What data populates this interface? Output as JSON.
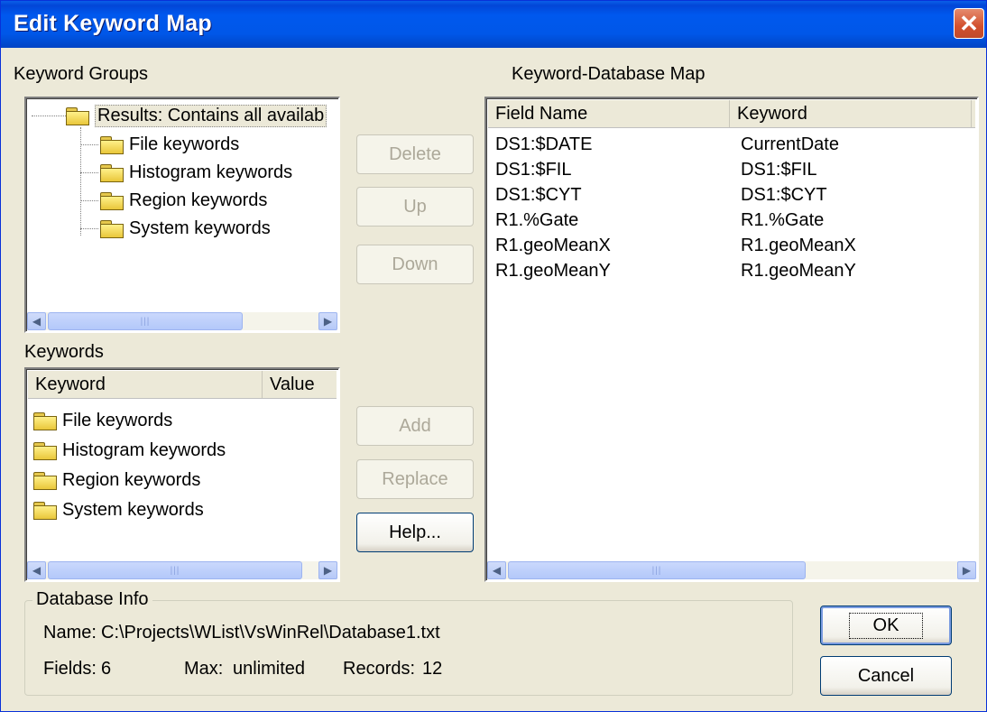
{
  "window": {
    "title": "Edit Keyword Map",
    "close_icon": "close-icon"
  },
  "keyword_groups": {
    "label": "Keyword Groups",
    "root": "Results: Contains all availab",
    "children": [
      "File keywords",
      "Histogram keywords",
      "Region keywords",
      "System keywords"
    ]
  },
  "keywords": {
    "label": "Keywords",
    "columns": [
      "Keyword",
      "Value"
    ],
    "items": [
      "File keywords",
      "Histogram keywords",
      "Region keywords",
      "System keywords"
    ]
  },
  "buttons": {
    "delete": "Delete",
    "up": "Up",
    "down": "Down",
    "add": "Add",
    "replace": "Replace",
    "help": "Help...",
    "ok": "OK",
    "cancel": "Cancel"
  },
  "map": {
    "label": "Keyword-Database Map",
    "columns": [
      "Field Name",
      "Keyword"
    ],
    "rows": [
      [
        "DS1:$DATE",
        "CurrentDate"
      ],
      [
        "DS1:$FIL",
        "DS1:$FIL"
      ],
      [
        "DS1:$CYT",
        "DS1:$CYT"
      ],
      [
        "R1.%Gate",
        "R1.%Gate"
      ],
      [
        "R1.geoMeanX",
        "R1.geoMeanX"
      ],
      [
        "R1.geoMeanY",
        "R1.geoMeanY"
      ]
    ]
  },
  "database_info": {
    "label": "Database Info",
    "name_label": "Name:",
    "name_value": "C:\\Projects\\WList\\VsWinRel\\Database1.txt",
    "fields_label": "Fields:",
    "fields_value": "6",
    "max_label": "Max:",
    "max_value": "unlimited",
    "records_label": "Records:",
    "records_value": "12"
  },
  "colors": {
    "titlebar": "#0058EE",
    "face": "#ECE9D8",
    "close": "#D2502E"
  }
}
